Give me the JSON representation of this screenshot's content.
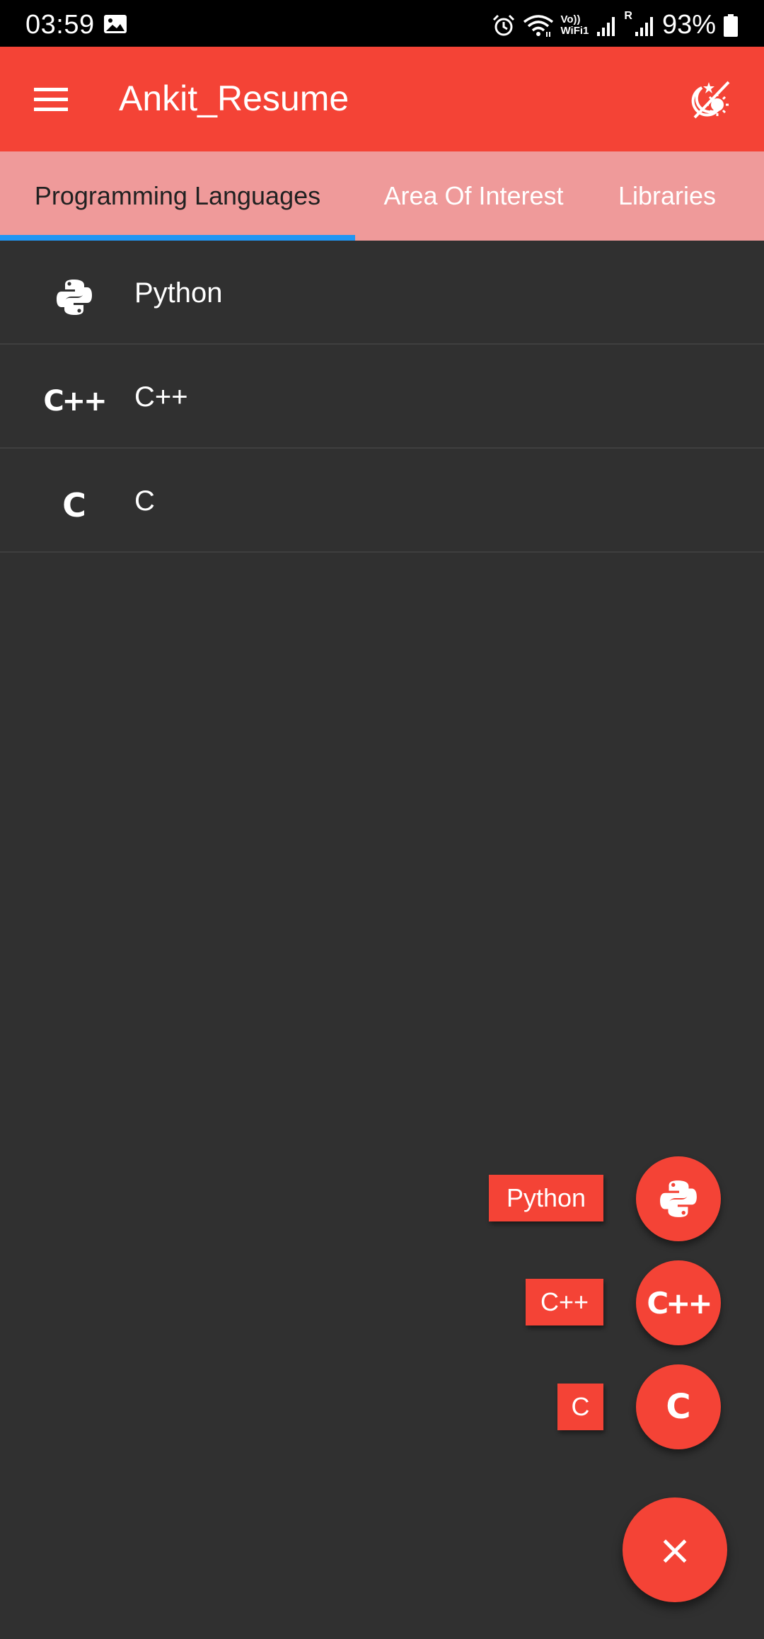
{
  "status_bar": {
    "time": "03:59",
    "battery": "93%",
    "network_label_top": "Vo))",
    "network_label_bottom": "WiFi1",
    "sim_label": "R",
    "icons": [
      "gallery-icon",
      "alarm-icon",
      "wifi-icon",
      "signal-icon",
      "signal-icon",
      "battery-icon"
    ]
  },
  "app_bar": {
    "title": "Ankit_Resume",
    "menu_icon": "hamburger-menu-icon",
    "theme_icon": "theme-toggle-icon"
  },
  "tabs": [
    {
      "label": "Programming Languages",
      "active": true
    },
    {
      "label": "Area Of Interest",
      "active": false
    },
    {
      "label": "Libraries",
      "active": false
    }
  ],
  "list": [
    {
      "label": "Python",
      "icon": "python-icon"
    },
    {
      "label": "C++",
      "icon": "cplusplus-icon",
      "glyph": "C++"
    },
    {
      "label": "C",
      "icon": "c-icon",
      "glyph": "C"
    }
  ],
  "speed_dial": {
    "items": [
      {
        "label": "Python",
        "icon": "python-icon"
      },
      {
        "label": "C++",
        "icon": "cplusplus-icon",
        "glyph": "C++"
      },
      {
        "label": "C",
        "icon": "c-icon",
        "glyph": "C"
      }
    ],
    "close_glyph": "×",
    "close_icon": "close-icon"
  },
  "colors": {
    "primary": "#f44336",
    "tab_background": "#ef9a9a",
    "tab_indicator": "#2196f3",
    "background": "#303030",
    "divider": "#3f3f3f"
  }
}
